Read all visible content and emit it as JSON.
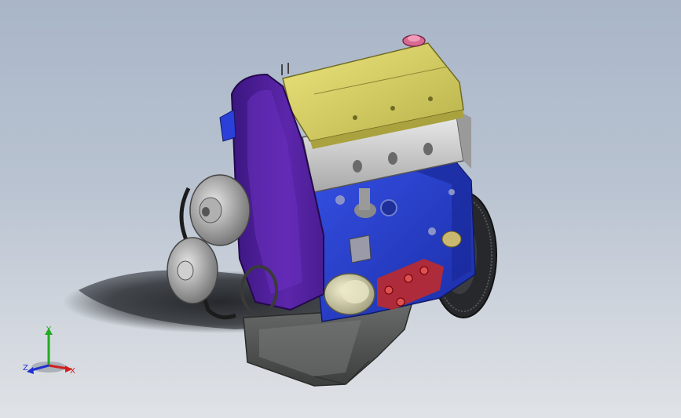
{
  "viewport": {
    "background_top": "#a9b6c8",
    "background_bottom": "#dfe2e6"
  },
  "model": {
    "parts": [
      {
        "part": "valve-cover",
        "color": "#dcd46a"
      },
      {
        "part": "cylinder-head",
        "color": "#d4d4d4"
      },
      {
        "part": "engine-block",
        "color": "#2a3fd0"
      },
      {
        "part": "timing-belt-cover",
        "color": "#5a23a6"
      },
      {
        "part": "oil-pan",
        "color": "#5e6060"
      },
      {
        "part": "oil-filter",
        "color": "#dcd9b6"
      },
      {
        "part": "oil-filler-cap",
        "color": "#d05a86"
      },
      {
        "part": "accessory-pulleys",
        "color": "#b8b8b8"
      },
      {
        "part": "flywheel",
        "color": "#303235"
      },
      {
        "part": "mount-bracket",
        "color": "#c2262c"
      }
    ]
  },
  "triad": {
    "y_label": "Y",
    "x_label": "X",
    "z_label": "Z",
    "y_color": "#22aa22",
    "x_color": "#d02020",
    "z_color": "#2030d0"
  }
}
